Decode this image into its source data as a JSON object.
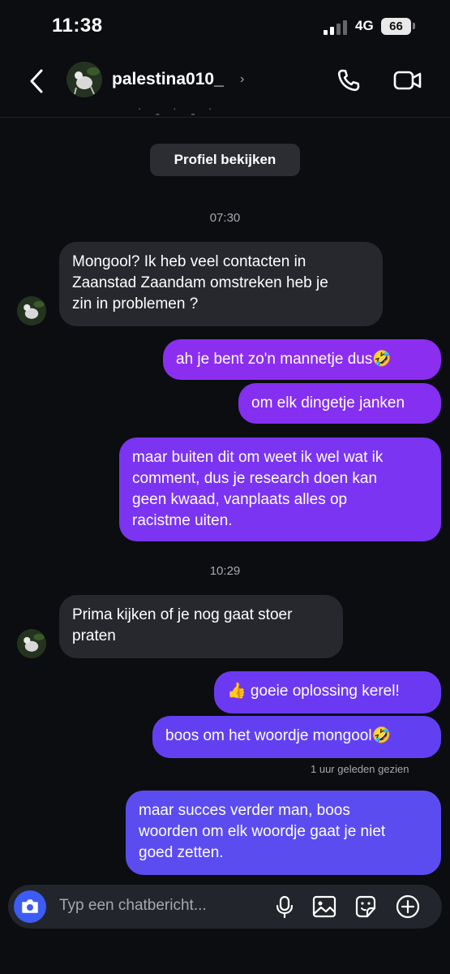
{
  "status": {
    "time": "11:38",
    "network": "4G",
    "battery": "66"
  },
  "header": {
    "username": "palestina010_",
    "chevron": "›",
    "icons": {
      "back": "chevron-left-icon",
      "call": "phone-icon",
      "video": "video-camera-icon"
    }
  },
  "profile_button": "Profiel bekijken",
  "conversation": {
    "time_1": "07:30",
    "time_2": "10:29",
    "messages": [
      {
        "from": "them",
        "text": "Mongool? Ik heb veel contacten in\nZaanstad Zaandam omstreken heb je\nzin in problemen ?"
      },
      {
        "from": "me",
        "text": "ah je bent zo'n mannetje dus🤣"
      },
      {
        "from": "me",
        "text": "om elk dingetje janken"
      },
      {
        "from": "me",
        "text": "maar buiten dit om weet ik wel wat ik\ncomment, dus je research doen kan\ngeen kwaad, vanplaats alles op\nracistme uiten."
      },
      {
        "from": "them",
        "text": "Prima kijken of je nog gaat stoer\npraten"
      },
      {
        "from": "me",
        "text": "👍 goeie oplossing kerel!"
      },
      {
        "from": "me",
        "text": "boos om het woordje mongool🤣"
      },
      {
        "from": "me",
        "text": "maar succes verder man, boos\nwoorden om elk woordje gaat je niet\ngoed zetten."
      }
    ],
    "seen_text": "1 uur geleden gezien"
  },
  "composer": {
    "placeholder": "Typ een chatbericht...",
    "icons": [
      "camera-icon",
      "microphone-icon",
      "gallery-icon",
      "sticker-icon",
      "plus-icon"
    ]
  },
  "colors": {
    "accent_purple": "#7b2ff2",
    "accent_blue": "#5b4bf0",
    "camera_blue": "#3d5cf5"
  }
}
